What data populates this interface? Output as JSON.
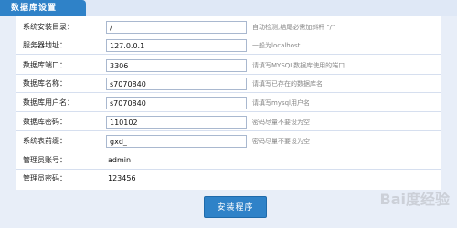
{
  "header": {
    "title": "数据库设置"
  },
  "form": {
    "rows": [
      {
        "label": "系统安装目录：",
        "value": "/",
        "hint": "自动检测,结尾必需加斜杆 \"/\""
      },
      {
        "label": "服务器地址：",
        "value": "127.0.0.1",
        "hint": "一般为localhost"
      },
      {
        "label": "数据库端口：",
        "value": "3306",
        "hint": "请填写MYSQL数据库使用的端口"
      },
      {
        "label": "数据库名称：",
        "value": "s7070840",
        "hint": "请填写已存在的数据库名"
      },
      {
        "label": "数据库用户名：",
        "value": "s7070840",
        "hint": "请填写mysql用户名"
      },
      {
        "label": "数据库密码：",
        "value": "110102",
        "hint": "密码尽量不要设为空"
      },
      {
        "label": "系统表前缀：",
        "value": "gxd_",
        "hint": "密码尽量不要设为空"
      }
    ],
    "admin_user": {
      "label": "管理员账号：",
      "value": "admin"
    },
    "admin_pass": {
      "label": "管理员密码：",
      "value": "123456"
    }
  },
  "footer": {
    "install_label": "安装程序"
  },
  "watermark": "Bai度经验"
}
